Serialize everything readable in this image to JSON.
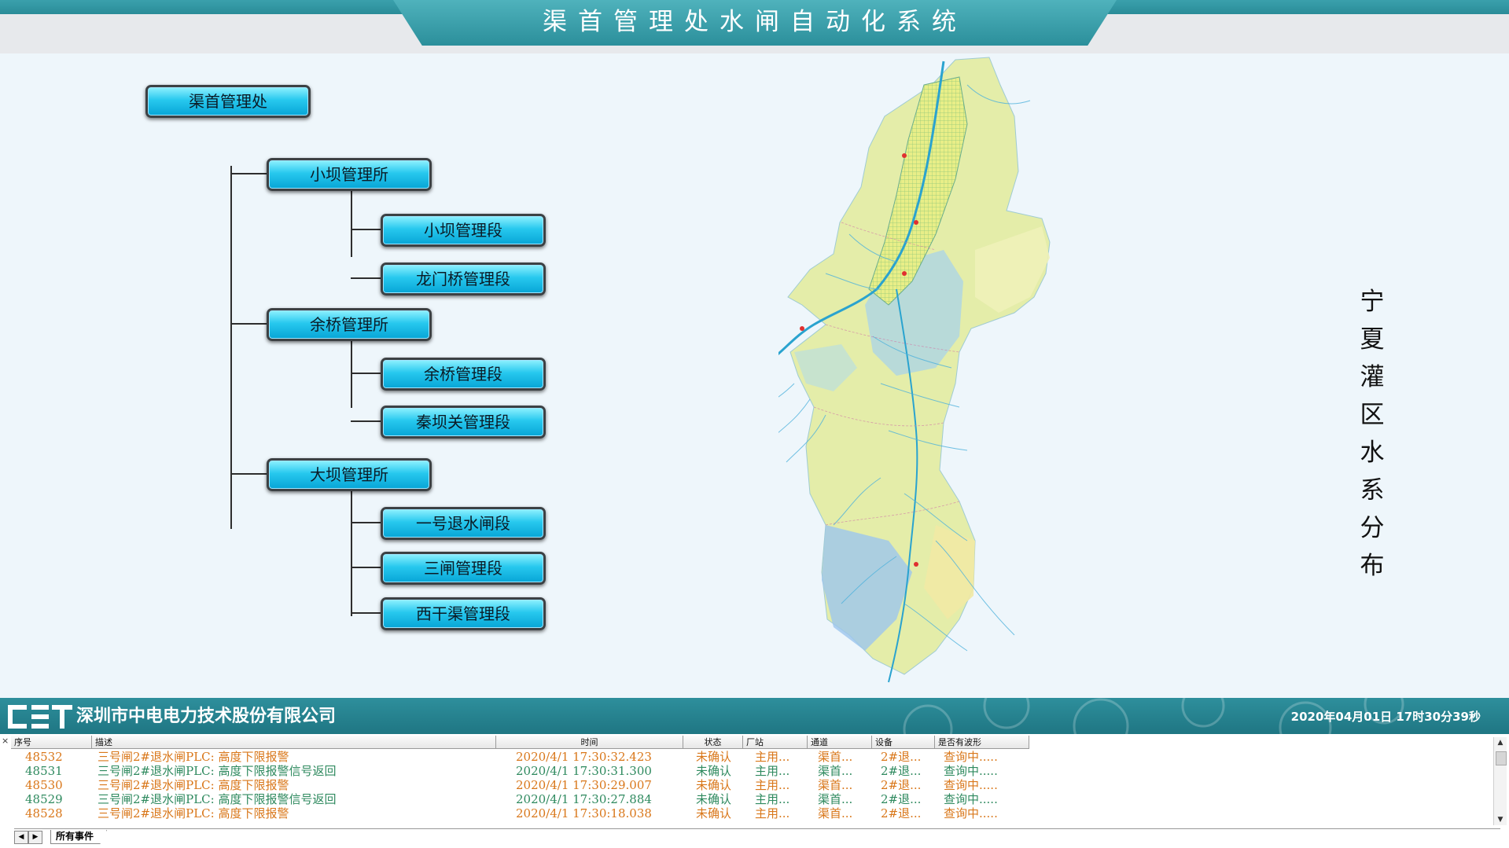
{
  "header": {
    "title": "渠首管理处水闸自动化系统"
  },
  "tree": {
    "root": "渠首管理处",
    "stations": [
      {
        "label": "小坝管理所",
        "sections": [
          "小坝管理段",
          "龙门桥管理段"
        ]
      },
      {
        "label": "余桥管理所",
        "sections": [
          "余桥管理段",
          "秦坝关管理段"
        ]
      },
      {
        "label": "大坝管理所",
        "sections": [
          "一号退水闸段",
          "三闸管理段",
          "西干渠管理段"
        ]
      }
    ]
  },
  "map": {
    "label": "宁夏灌区水系分布"
  },
  "footer": {
    "logo_text": "CET",
    "company": "深圳市中电电力技术股份有限公司",
    "datetime": "2020年04月01日 17时30分39秒"
  },
  "events": {
    "close_glyph": "×",
    "columns": [
      "序号",
      "描述",
      "时间",
      "状态",
      "厂站",
      "通道",
      "设备",
      "是否有波形"
    ],
    "rows": [
      {
        "id": "48532",
        "desc": "三号闸2#退水闸PLC: 高度下限报警",
        "time": "2020/4/1 17:30:32.423",
        "status": "未确认",
        "station": "主用...",
        "channel": "渠首...",
        "device": "2#退...",
        "wave": "查询中.....",
        "color": "#d9771a"
      },
      {
        "id": "48531",
        "desc": "三号闸2#退水闸PLC: 高度下限报警信号返回",
        "time": "2020/4/1 17:30:31.300",
        "status": "未确认",
        "station": "主用...",
        "channel": "渠首...",
        "device": "2#退...",
        "wave": "查询中.....",
        "color": "#2f8a5f"
      },
      {
        "id": "48530",
        "desc": "三号闸2#退水闸PLC: 高度下限报警",
        "time": "2020/4/1 17:30:29.007",
        "status": "未确认",
        "station": "主用...",
        "channel": "渠首...",
        "device": "2#退...",
        "wave": "查询中.....",
        "color": "#d9771a"
      },
      {
        "id": "48529",
        "desc": "三号闸2#退水闸PLC: 高度下限报警信号返回",
        "time": "2020/4/1 17:30:27.884",
        "status": "未确认",
        "station": "主用...",
        "channel": "渠首...",
        "device": "2#退...",
        "wave": "查询中.....",
        "color": "#2f8a5f"
      },
      {
        "id": "48528",
        "desc": "三号闸2#退水闸PLC: 高度下限报警",
        "time": "2020/4/1 17:30:18.038",
        "status": "未确认",
        "station": "主用...",
        "channel": "渠首...",
        "device": "2#退...",
        "wave": "查询中.....",
        "color": "#d9771a"
      }
    ],
    "tabs": [
      "所有事件"
    ],
    "nav_prev": "◀",
    "nav_next": "▶",
    "scroll_up": "▲",
    "scroll_down": "▼"
  }
}
